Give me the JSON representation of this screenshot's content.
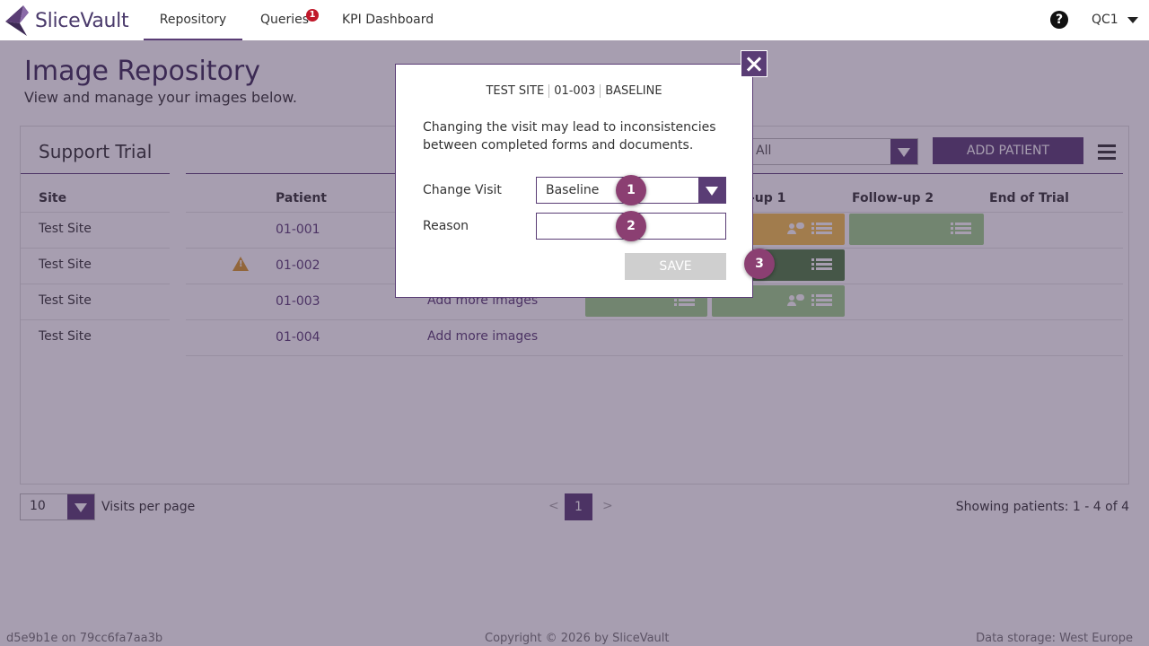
{
  "nav": {
    "brand": "SliceVault",
    "items": [
      {
        "label": "Repository",
        "active": true
      },
      {
        "label": "Queries",
        "badge": "1"
      },
      {
        "label": "KPI Dashboard"
      }
    ],
    "help": "?",
    "user": "QC1"
  },
  "page": {
    "title": "Image Repository",
    "subtitle": "View and manage your images below."
  },
  "card": {
    "trial": "Support Trial",
    "filter_value": "All",
    "add_patient": "ADD PATIENT",
    "columns": {
      "site": "Site",
      "patient": "Patient",
      "followup1": "-up 1",
      "followup2": "Follow-up 2",
      "end": "End of Trial"
    },
    "rows": [
      {
        "site": "Test Site",
        "patient": "01-001",
        "action": ""
      },
      {
        "site": "Test Site",
        "patient": "01-002",
        "action": ""
      },
      {
        "site": "Test Site",
        "patient": "01-003",
        "action": "Add more images"
      },
      {
        "site": "Test Site",
        "patient": "01-004",
        "action": "Add more images"
      }
    ]
  },
  "footer": {
    "per_page_value": "10",
    "per_page_label": "Visits per page",
    "prev": "<",
    "current_page": "1",
    "next": ">",
    "showing": "Showing patients: 1 - 4 of 4",
    "version": "d5e9b1e on 79cc6fa7aa3b",
    "copyright": "Copyright © 2026 by SliceVault",
    "storage": "Data storage: West Europe"
  },
  "modal": {
    "crumb_site": "TEST SITE",
    "crumb_patient": "01-003",
    "crumb_visit": "BASELINE",
    "message": "Changing the visit may lead to inconsistencies between completed forms and documents.",
    "change_visit_label": "Change Visit",
    "change_visit_value": "Baseline",
    "reason_label": "Reason",
    "reason_value": "",
    "save_label": "SAVE"
  },
  "steps": [
    "1",
    "2",
    "3"
  ],
  "colors": {
    "brand": "#5a3d75",
    "visit_green": "#9ed28a",
    "visit_yellow": "#f5c24b",
    "visit_dark": "#4f7e43",
    "step_badge": "#8b3f72",
    "query_badge": "#c0182a"
  }
}
